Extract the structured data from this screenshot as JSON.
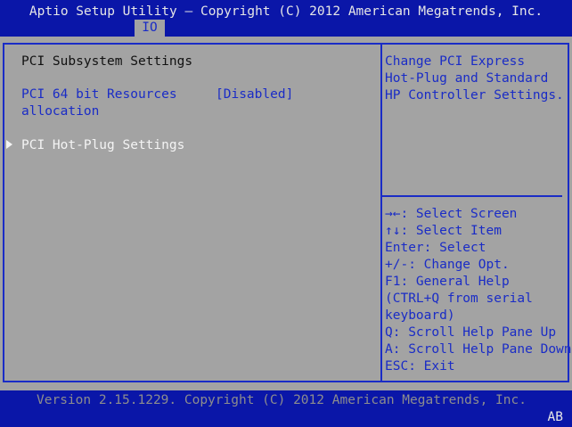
{
  "header": {
    "title": "Aptio Setup Utility – Copyright (C) 2012 American Megatrends, Inc.",
    "active_tab": "IO"
  },
  "main": {
    "section_title": "PCI Subsystem Settings",
    "setting": {
      "label_line1": "PCI 64 bit Resources",
      "label_line2": "allocation",
      "value": "[Disabled]"
    },
    "submenu": {
      "label": "PCI Hot-Plug Settings"
    }
  },
  "help": {
    "description_lines": [
      "Change PCI Express",
      "Hot-Plug and Standard",
      "HP Controller Settings."
    ],
    "keys": [
      "→←: Select Screen",
      "↑↓: Select Item",
      "Enter: Select",
      "+/-: Change Opt.",
      "F1: General Help",
      "(CTRL+Q from serial",
      "keyboard)",
      "Q: Scroll Help Pane Up",
      "A: Scroll Help Pane Down",
      "ESC: Exit"
    ]
  },
  "footer": {
    "version": "Version 2.15.1229. Copyright (C) 2012 American Megatrends, Inc.",
    "corner_code": "AB"
  },
  "colors": {
    "background": "#a3a3a3",
    "bar_blue": "#0a16a8",
    "accent_blue": "#1a2cc6",
    "highlight_white": "#f4f4f4"
  }
}
